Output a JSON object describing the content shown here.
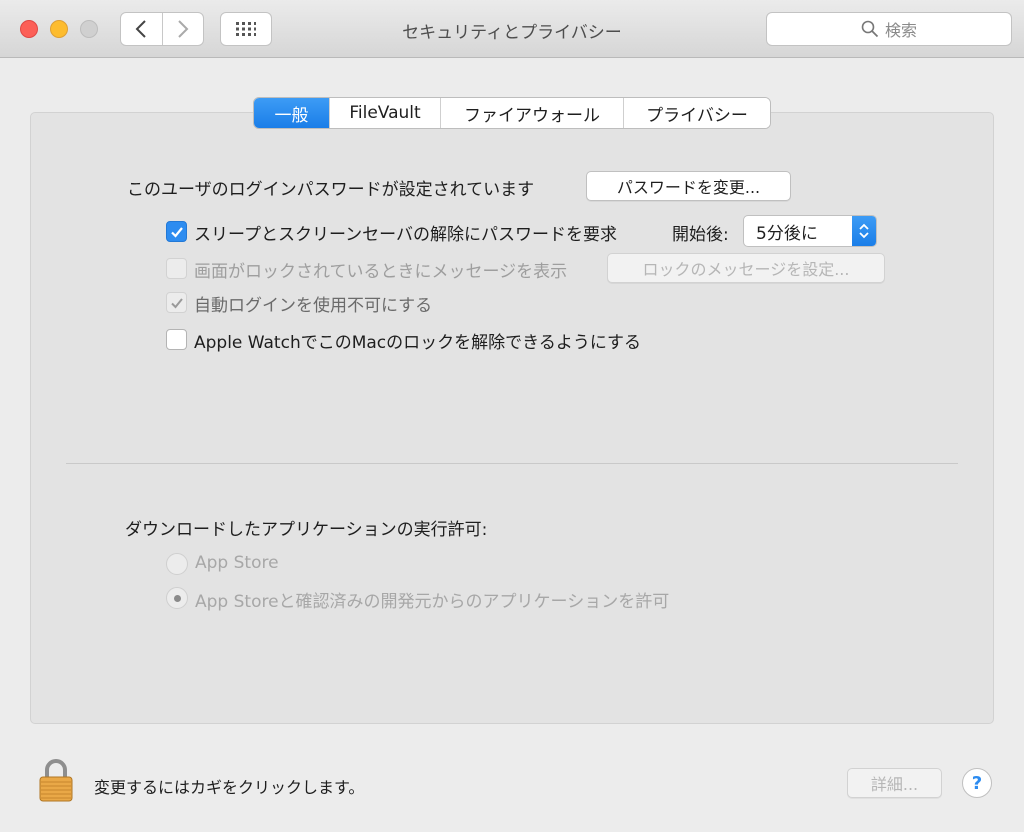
{
  "window": {
    "title": "セキュリティとプライバシー"
  },
  "toolbar": {
    "search_placeholder": "検索"
  },
  "tabs": [
    {
      "label": "一般",
      "active": true
    },
    {
      "label": "FileVault",
      "active": false
    },
    {
      "label": "ファイアウォール",
      "active": false
    },
    {
      "label": "プライバシー",
      "active": false
    }
  ],
  "general": {
    "login_password_text": "このユーザのログインパスワードが設定されています",
    "change_password_button": "パスワードを変更...",
    "require_password": {
      "label": "スリープとスクリーンセーバの解除にパスワードを要求",
      "checked": true
    },
    "start_after_label": "開始後:",
    "start_after_value": "5分後に",
    "show_message": {
      "label": "画面がロックされているときにメッセージを表示",
      "checked": false,
      "enabled": false
    },
    "set_lock_message_button": "ロックのメッセージを設定...",
    "disable_auto_login": {
      "label": "自動ログインを使用不可にする",
      "checked": true,
      "enabled": false
    },
    "apple_watch_unlock": {
      "label": "Apple WatchでこのMacのロックを解除できるようにする",
      "checked": false
    }
  },
  "downloads": {
    "heading": "ダウンロードしたアプリケーションの実行許可:",
    "options": [
      {
        "label": "App Store",
        "selected": false
      },
      {
        "label": "App Storeと確認済みの開発元からのアプリケーションを許可",
        "selected": true
      }
    ]
  },
  "footer": {
    "lock_text": "変更するにはカギをクリックします。",
    "advanced_button": "詳細...",
    "help_label": "?"
  },
  "colors": {
    "accent": "#2d8cf0",
    "close": "#fc5f57",
    "minimize": "#fdbc2e"
  }
}
